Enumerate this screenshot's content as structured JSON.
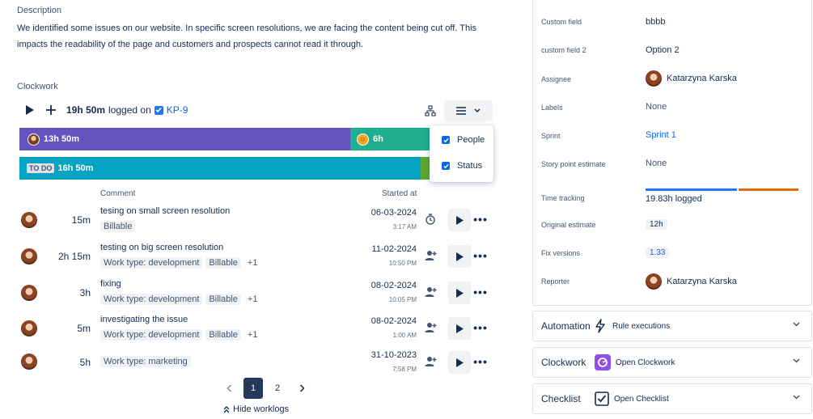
{
  "description": {
    "title": "Description",
    "line1": "We identified some issues on our website. In specific screen resolutions, we are facing the content being cut off. This",
    "line2": "impacts the readability of the page and customers and prospects cannot read it through."
  },
  "clockwork": {
    "title": "Clockwork",
    "logged_total": "19h 50m",
    "logged_on": "logged on",
    "issue_key": "KP-9",
    "bar1": {
      "seg_a_label": "13h 50m",
      "seg_b_label": "6h"
    },
    "bar2": {
      "status": "TO DO",
      "label": "16h 50m"
    },
    "dropdown": {
      "items": [
        "People",
        "Status"
      ]
    },
    "columns": {
      "comment": "Comment",
      "started_at": "Started at"
    },
    "worklogs": [
      {
        "duration": "15m",
        "comment": "tesing on small screen resolution",
        "tags": [
          "Billable"
        ],
        "date": "06-03-2024",
        "time": "3:17 AM",
        "icon": "stopwatch-icon"
      },
      {
        "duration": "2h 15m",
        "comment": "testing on big screen resolution",
        "tags": [
          "Work type: development",
          "Billable",
          "+1"
        ],
        "date": "11-02-2024",
        "time": "10:50 PM",
        "icon": "add-person-icon"
      },
      {
        "duration": "3h",
        "comment": "fixing",
        "tags": [
          "Work type: development",
          "Billable",
          "+1"
        ],
        "date": "08-02-2024",
        "time": "10:05 PM",
        "icon": "add-person-icon"
      },
      {
        "duration": "5m",
        "comment": "investigating the issue",
        "tags": [
          "Work type: development",
          "Billable",
          "+1"
        ],
        "date": "08-02-2024",
        "time": "1:00 AM",
        "icon": "add-person-icon"
      },
      {
        "duration": "5h",
        "comment": "",
        "tags": [
          "Work type: marketing"
        ],
        "date": "31-10-2023",
        "time": "7:58 PM",
        "icon": "add-person-icon"
      }
    ],
    "pagination": {
      "pages": [
        "1",
        "2"
      ],
      "current": "1"
    },
    "hide_worklogs": "Hide worklogs"
  },
  "details": {
    "fields": [
      {
        "label": "Custom field",
        "value": "bbbb"
      },
      {
        "label": "custom field 2",
        "value": "Option 2"
      },
      {
        "label": "Assignee",
        "value": "Katarzyna Karska"
      },
      {
        "label": "Labels",
        "value": "None"
      },
      {
        "label": "Sprint",
        "value": "Sprint 1"
      },
      {
        "label": "Story point estimate",
        "value": "None"
      },
      {
        "label": "Time tracking",
        "value": "19.83h logged"
      },
      {
        "label": "Original estimate",
        "value": "12h"
      },
      {
        "label": "Fix versions",
        "value": "1.33"
      },
      {
        "label": "Reporter",
        "value": "Katarzyna Karska"
      }
    ]
  },
  "cards": [
    {
      "title": "Automation",
      "sub": "Rule executions"
    },
    {
      "title": "Clockwork",
      "sub": "Open Clockwork"
    },
    {
      "title": "Checklist",
      "sub": "Open Checklist"
    }
  ],
  "colors": {
    "purple": "#6554c0",
    "teal": "#1fae8e",
    "cyan": "#05a3c4",
    "green": "#5fa832",
    "link": "#0c66e4"
  }
}
